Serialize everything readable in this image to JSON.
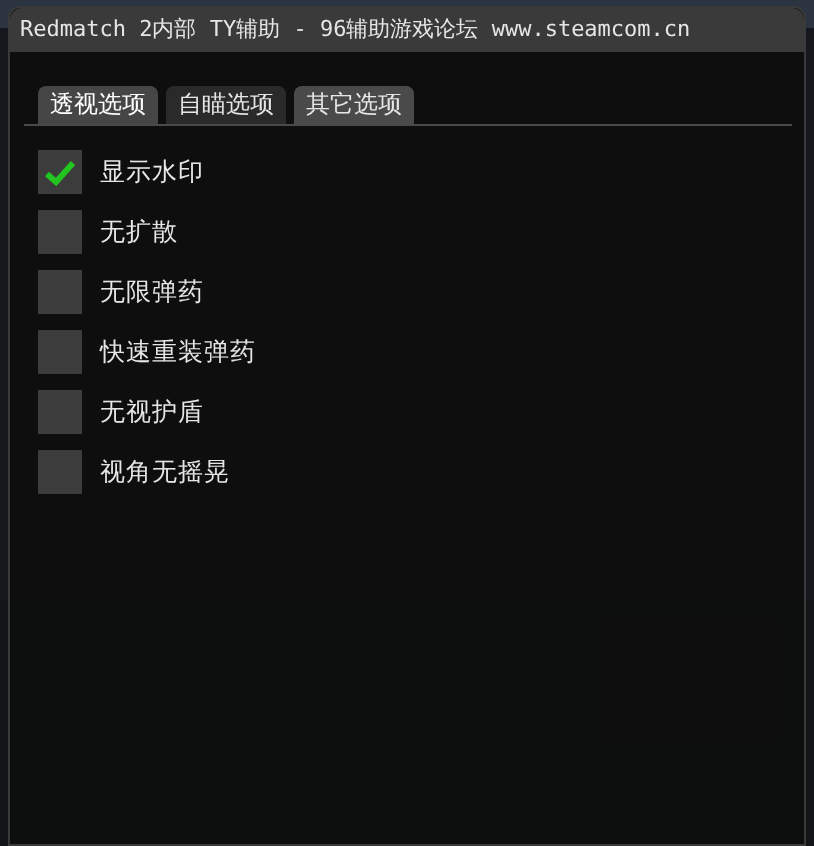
{
  "window": {
    "title": "Redmatch 2内部 TY辅助 - 96辅助游戏论坛 www.steamcom.cn"
  },
  "tabs": [
    {
      "label": "透视选项",
      "selected": false,
      "hovered": true
    },
    {
      "label": "自瞄选项",
      "selected": false,
      "hovered": false
    },
    {
      "label": "其它选项",
      "selected": true,
      "hovered": false
    }
  ],
  "options": [
    {
      "label": "显示水印",
      "checked": true
    },
    {
      "label": "无扩散",
      "checked": false
    },
    {
      "label": "无限弹药",
      "checked": false
    },
    {
      "label": "快速重装弹药",
      "checked": false
    },
    {
      "label": "无视护盾",
      "checked": false
    },
    {
      "label": "视角无摇晃",
      "checked": false
    }
  ]
}
